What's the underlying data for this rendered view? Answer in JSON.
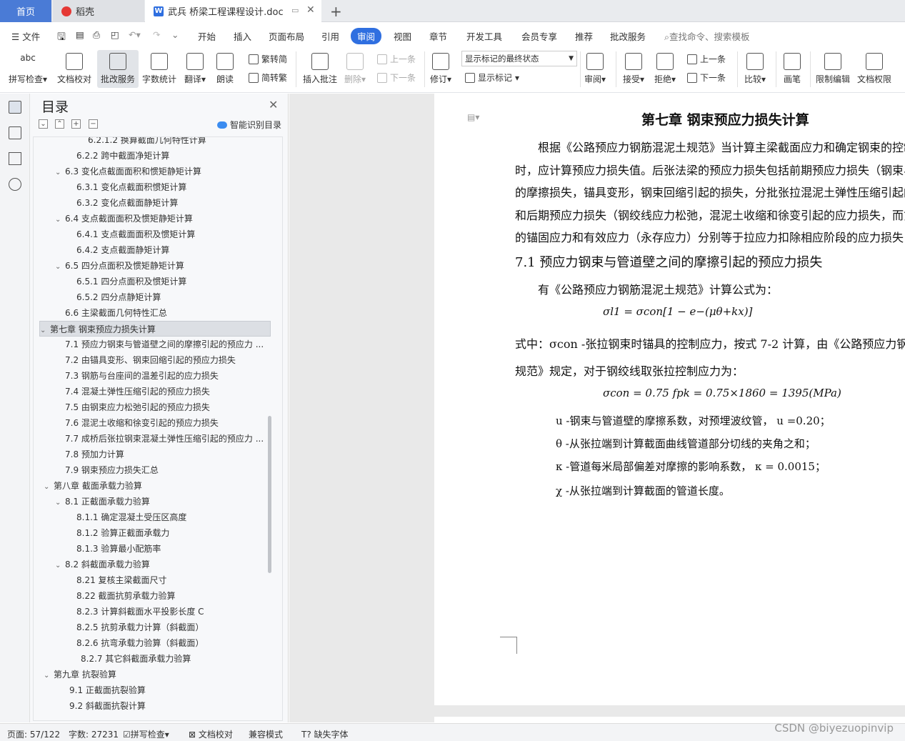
{
  "tabs": {
    "home": "首页",
    "daoke": "稻壳",
    "doc": "武兵 桥梁工程课程设计.doc",
    "new": "+"
  },
  "menu": {
    "file": "文件",
    "items": [
      "开始",
      "插入",
      "页面布局",
      "引用",
      "审阅",
      "视图",
      "章节",
      "开发工具",
      "会员专享",
      "推荐",
      "批改服务"
    ],
    "search": "查找命令、搜索模板"
  },
  "ribbon": {
    "spell": "拼写检查",
    "proof": "文档校对",
    "review_service": "批改服务",
    "wordcount": "字数统计",
    "translate": "翻译",
    "read": "朗读",
    "t2s": "繁转简",
    "s2t": "简转繁",
    "insert_comment": "插入批注",
    "delete": "删除",
    "prev": "上一条",
    "next": "下一条",
    "track": "修订",
    "display_dropdown": "显示标记的最终状态",
    "show_marks": "显示标记",
    "review": "审阅",
    "accept": "接受",
    "reject": "拒绝",
    "prev2": "上一条",
    "next2": "下一条",
    "compare": "比较",
    "pen": "画笔",
    "restrict": "限制编辑",
    "perm": "文档权限"
  },
  "toc": {
    "title": "目录",
    "smart": "智能识别目录",
    "items": [
      {
        "t": "6.2.1.2 换算截面几何特性计算",
        "l": 3
      },
      {
        "t": "6.2.2 跨中截面净矩计算",
        "l": 2
      },
      {
        "t": "6.3  变化点截面面积和惯矩静矩计算",
        "l": 1,
        "c": true
      },
      {
        "t": "6.3.1 变化点截面积惯矩计算",
        "l": 2
      },
      {
        "t": "6.3.2  变化点截面静矩计算",
        "l": 2
      },
      {
        "t": "6.4  支点截面面积及惯矩静矩计算",
        "l": 1,
        "c": true
      },
      {
        "t": "6.4.1  支点截面面积及惯矩计算",
        "l": 2
      },
      {
        "t": "6.4.2  支点截面静矩计算",
        "l": 2
      },
      {
        "t": "6.5 四分点面积及惯矩静矩计算",
        "l": 1,
        "c": true
      },
      {
        "t": "6.5.1 四分点面积及惯矩计算",
        "l": 2
      },
      {
        "t": "6.5.2 四分点静矩计算",
        "l": 2
      },
      {
        "t": "6.6 主梁截面几何特性汇总",
        "l": 1
      },
      {
        "t": "第七章  钢束预应力损失计算",
        "l": 0,
        "c": true,
        "sel": true
      },
      {
        "t": "7.1  预应力钢束与管道壁之间的摩擦引起的预应力 ...",
        "l": 1
      },
      {
        "t": "7.2  由锚具变形、钢束回缩引起的预应力损失",
        "l": 1
      },
      {
        "t": "7.3  钢筋与台座间的温差引起的应力损失",
        "l": 1
      },
      {
        "t": "7.4  混凝土弹性压缩引起的预应力损失",
        "l": 1
      },
      {
        "t": "7.5  由钢束应力松弛引起的预应力损失",
        "l": 1
      },
      {
        "t": "7.6  混泥土收缩和徐变引起的预应力损失",
        "l": 1
      },
      {
        "t": "7.7 成桥后张拉钢束混凝土弹性压缩引起的预应力 ...",
        "l": 1
      },
      {
        "t": "7.8 预加力计算",
        "l": 1
      },
      {
        "t": "7.9 钢束预应力损失汇总",
        "l": 1
      },
      {
        "t": "第八章   截面承载力验算",
        "l": 0,
        "c": true
      },
      {
        "t": "8.1  正截面承载力验算",
        "l": 1,
        "c": true
      },
      {
        "t": "8.1.1  确定混凝土受压区高度",
        "l": 2
      },
      {
        "t": "8.1.2 验算正截面承载力",
        "l": 2
      },
      {
        "t": "8.1.3 验算最小配筋率",
        "l": 2
      },
      {
        "t": "8.2 斜截面承载力验算",
        "l": 1,
        "c": true
      },
      {
        "t": "8.21 复核主梁截面尺寸",
        "l": 2
      },
      {
        "t": "8.22 截面抗剪承载力验算",
        "l": 2
      },
      {
        "t": "8.2.3 计算斜截面水平投影长度 C",
        "l": 2
      },
      {
        "t": "8.2.5 抗剪承载力计算（斜截面）",
        "l": 2
      },
      {
        "t": "8.2.6 抗弯承载力验算（斜截面）",
        "l": 2
      },
      {
        "t": "8.2.7 其它斜截面承载力验算",
        "l": 2.4
      },
      {
        "t": "第九章  抗裂验算",
        "l": 0,
        "c": true
      },
      {
        "t": "9.1 正截面抗裂验算",
        "l": 1.4
      },
      {
        "t": "9.2  斜截面抗裂计算",
        "l": 1.4
      }
    ]
  },
  "doc": {
    "heading": "第七章  钢束预应力损失计算",
    "p": [
      "根据《公路预应力钢筋混泥土规范》当计算主梁截面应力和确定钢束的控制",
      "时，应计算预应力损失值。后张法梁的预应力损失包括前期预应力损失（钢束与",
      "的摩擦损失，锚具变形，钢束回缩引起的损失，分批张拉混泥土弹性压缩引起的",
      "和后期预应力损失（钢绞线应力松弛，混泥土收缩和徐变引起的应力损失，而第",
      "的锚固应力和有效应力（永存应力）分别等于拉应力扣除相应阶段的应力损失"
    ],
    "h2": "7.1  预应力钢束与管道壁之间的摩擦引起的预应力损失",
    "p2": "有《公路预应力钢筋混泥土规范》计算公式为：",
    "f1": "σl1 = σcon[1 − e−(μθ+kx)]",
    "p3a": "式中：σcon -张拉钢束时锚具的控制应力，按式 7-2 计算，由《公路预应力钢筋",
    "p3b": "规范》规定，对于钢绞线取张拉控制应力为：",
    "f2": "σcon = 0.75 fpk = 0.75×1860 = 1395(MPa)",
    "d1": "u -钢束与管道壁的摩擦系数，对预埋波纹管，  u =0.20；",
    "d2": "θ -从张拉端到计算截面曲线管道部分切线的夹角之和；",
    "d3": "κ -管道每米局部偏差对摩擦的影响系数， κ = 0.0015；",
    "d4": "χ -从张拉端到计算截面的管道长度。"
  },
  "status": {
    "page": "页面: 57/122",
    "words": "字数: 27231",
    "spell": "拼写检查",
    "proof": "文档校对",
    "compat": "兼容模式",
    "font": "缺失字体"
  },
  "watermark": "CSDN @biyezuopinvip",
  "colors": {
    "accent": "#2f6fe0",
    "home_tab": "#4a7bd6"
  }
}
